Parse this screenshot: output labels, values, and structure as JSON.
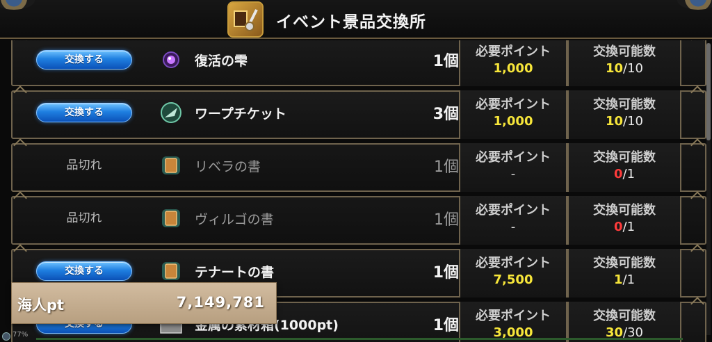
{
  "header": {
    "title": "イベント景品交換所"
  },
  "columns": {
    "points_label": "必要ポイント",
    "count_label": "交換可能数"
  },
  "rows": [
    {
      "action": "交換する",
      "soldout": false,
      "icon": "purple-orb-icon",
      "name": "復活の雫",
      "qty": "1個",
      "points": "1,000",
      "avail": "10",
      "max": "10"
    },
    {
      "action": "交換する",
      "soldout": false,
      "icon": "warp-ticket-icon",
      "name": "ワープチケット",
      "qty": "3個",
      "points": "1,000",
      "avail": "10",
      "max": "10"
    },
    {
      "action": "品切れ",
      "soldout": true,
      "icon": "book-icon",
      "name": "リベラの書",
      "qty": "1個",
      "points": "-",
      "avail": "0",
      "max": "1"
    },
    {
      "action": "品切れ",
      "soldout": true,
      "icon": "book-icon",
      "name": "ヴィルゴの書",
      "qty": "1個",
      "points": "-",
      "avail": "0",
      "max": "1"
    },
    {
      "action": "交換する",
      "soldout": false,
      "icon": "book-icon",
      "name": "テナートの書",
      "qty": "1個",
      "points": "7,500",
      "avail": "1",
      "max": "1"
    },
    {
      "action": "交換する",
      "soldout": false,
      "icon": "metal-box-icon",
      "name": "金属の素材箱(1000pt)",
      "qty": "1個",
      "points": "3,000",
      "avail": "30",
      "max": "30"
    }
  ],
  "points_panel": {
    "label": "海人pt",
    "value": "7,149,781"
  },
  "zoom": "77%",
  "colors": {
    "button_blue": "#1f7fe0",
    "points_yellow": "#f7e63a",
    "zero_red": "#ff3b3b",
    "frame_gold": "#6f634d"
  }
}
